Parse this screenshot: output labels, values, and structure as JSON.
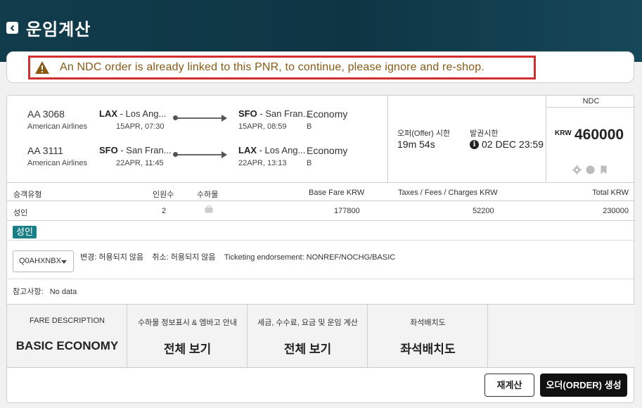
{
  "header": {
    "title": "운임계산"
  },
  "alert": {
    "message": "An NDC order is already linked to this PNR, to continue, please ignore and re-shop."
  },
  "segments": [
    {
      "flight": "AA 3068",
      "airline": "American Airlines",
      "dep_code": "LAX",
      "dep_city": " - Los Ang...",
      "dep_time": "15APR, 07:30",
      "arr_code": "SFO",
      "arr_city": " - San Fran...",
      "arr_time": "15APR, 08:59",
      "cabin": "Economy",
      "class": "B"
    },
    {
      "flight": "AA 3111",
      "airline": "American Airlines",
      "dep_code": "SFO",
      "dep_city": " - San Fran...",
      "dep_time": "22APR, 11:45",
      "arr_code": "LAX",
      "arr_city": " - Los Ang...",
      "arr_time": "22APR, 13:13",
      "cabin": "Economy",
      "class": "B"
    }
  ],
  "offer": {
    "offer_label": "오퍼(Offer) 시한",
    "offer_value": "19m  54s",
    "ticket_label": "발권시한",
    "ticket_value": "02 DEC 23:59"
  },
  "price": {
    "source": "NDC",
    "currency": "KRW",
    "amount": "460000"
  },
  "table": {
    "headers": {
      "pax_type": "승객유형",
      "count": "인원수",
      "baggage": "수하물",
      "base": "Base Fare KRW",
      "taxes": "Taxes / Fees / Charges KRW",
      "total": "Total KRW"
    },
    "row": {
      "pax_type": "성인",
      "count": "2",
      "base": "177800",
      "taxes": "52200",
      "total": "230000"
    }
  },
  "pax_badge": "성인",
  "fare_basis": {
    "selected": "Q0AHXNBX",
    "rules": "변경: 허용되지 않음    취소: 허용되지 않음    Ticketing endorsement: NONREF/NOCHG/BASIC"
  },
  "note": "참고사항:   No data",
  "tiles": [
    {
      "label": "FARE DESCRIPTION",
      "value": "BASIC ECONOMY"
    },
    {
      "label": "수하물 정보표시 & 엠바고 안내",
      "value": "전체 보기"
    },
    {
      "label": "세금, 수수료, 요금 및 운임 계산",
      "value": "전체 보기"
    },
    {
      "label": "좌석배치도",
      "value": "좌석배치도"
    }
  ],
  "buttons": {
    "recalc": "재계산",
    "create_order": "오더(ORDER) 생성"
  },
  "icons": {
    "back": "chevron-left-icon",
    "warning": "warning-icon",
    "info": "info-icon",
    "settings": "gear-icon",
    "circle": "circle-icon",
    "bookmark": "bookmark-icon",
    "baggage": "briefcase-icon"
  },
  "colors": {
    "header": "#113c4c",
    "alert_border": "#d32f2f",
    "alert_text": "#8a5a14",
    "badge": "#1a7f86"
  }
}
